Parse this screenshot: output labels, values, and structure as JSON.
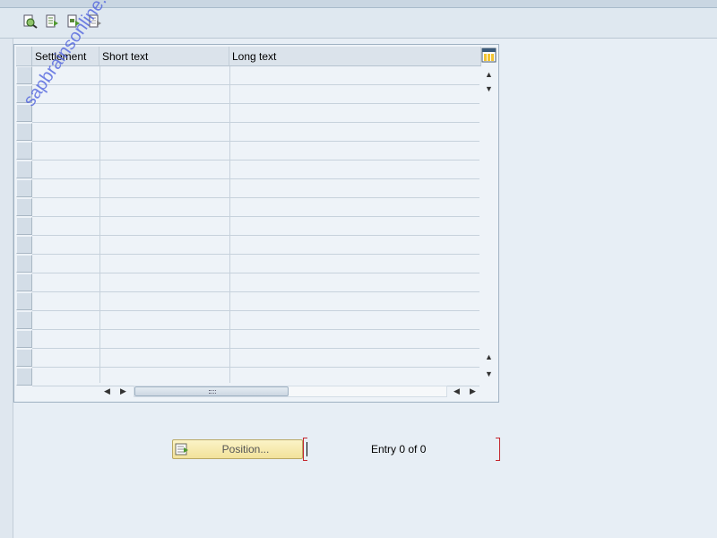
{
  "toolbar": {
    "buttons": [
      {
        "name": "find-button",
        "icon": "binoculars-icon"
      },
      {
        "name": "select-all-button",
        "icon": "select-all-icon"
      },
      {
        "name": "select-block-button",
        "icon": "select-block-icon"
      },
      {
        "name": "deselect-all-button",
        "icon": "deselect-all-icon"
      }
    ]
  },
  "table": {
    "columns": [
      {
        "key": "settlement",
        "label": "Settlement"
      },
      {
        "key": "short_text",
        "label": "Short text"
      },
      {
        "key": "long_text",
        "label": "Long text"
      }
    ],
    "row_count": 17,
    "rows": []
  },
  "footer": {
    "position_label": "Position...",
    "entry_text": "Entry 0 of 0"
  },
  "watermark": "sapbrainsonline.com",
  "colors": {
    "accent_button": "#f2e29a",
    "field_bracket": "#c4262e",
    "watermark": "#465adc"
  }
}
